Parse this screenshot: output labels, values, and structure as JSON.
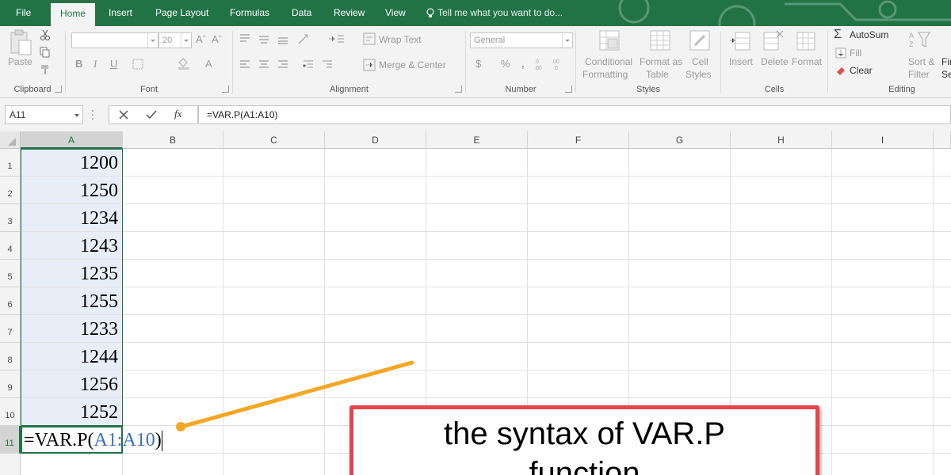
{
  "ribbon_tabs": [
    "File",
    "Home",
    "Insert",
    "Page Layout",
    "Formulas",
    "Data",
    "Review",
    "View"
  ],
  "tell_me": "Tell me what you want to do...",
  "clipboard": {
    "paste": "Paste",
    "label": "Clipboard"
  },
  "font": {
    "name": "",
    "size": "20",
    "label": "Font"
  },
  "alignment": {
    "wrap_text": "Wrap Text",
    "merge_center": "Merge & Center",
    "label": "Alignment"
  },
  "number": {
    "format": "General",
    "label": "Number"
  },
  "styles": {
    "conditional_1": "Conditional",
    "conditional_2": "Formatting",
    "format_as_1": "Format as",
    "format_as_2": "Table",
    "cell_1": "Cell",
    "cell_2": "Styles",
    "label": "Styles"
  },
  "cells": {
    "insert": "Insert",
    "delete": "Delete",
    "format": "Format",
    "label": "Cells"
  },
  "editing": {
    "autosum": "AutoSum",
    "fill": "Fill",
    "clear": "Clear",
    "sort_1": "Sort &",
    "sort_2": "Filter",
    "find_1": "Fir",
    "find_2": "Sel",
    "label": "Editing"
  },
  "formula_bar": {
    "name_box": "A11",
    "formula": "=VAR.P(A1:A10)"
  },
  "columns": [
    "A",
    "B",
    "C",
    "D",
    "E",
    "F",
    "G",
    "H",
    "I"
  ],
  "rows": [
    "1",
    "2",
    "3",
    "4",
    "5",
    "6",
    "7",
    "8",
    "9",
    "10",
    "11"
  ],
  "col_a_values": [
    "1200",
    "1250",
    "1234",
    "1243",
    "1235",
    "1255",
    "1233",
    "1244",
    "1256",
    "1252"
  ],
  "active_cell": {
    "prefix": "=VAR.P(",
    "ref": "A1:A10",
    "suffix": ")"
  },
  "callout": {
    "line1": "the syntax of VAR.P",
    "line2": "function"
  },
  "colors": {
    "excel_green": "#217346",
    "callout_border": "#e8434c",
    "arrow": "#f5a623",
    "ref_blue": "#3a70c1"
  }
}
